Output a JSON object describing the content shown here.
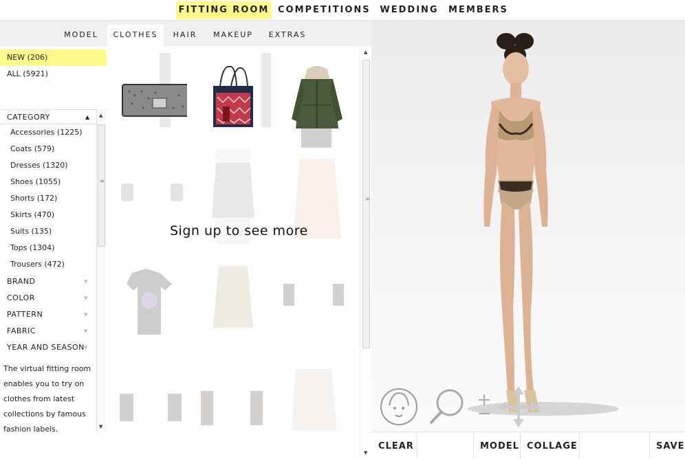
{
  "topnav": {
    "items": [
      {
        "label": "FITTING ROOM"
      },
      {
        "label": "COMPETITIONS"
      },
      {
        "label": "WEDDING"
      },
      {
        "label": "MEMBERS"
      }
    ]
  },
  "subtabs": [
    {
      "label": "MODEL"
    },
    {
      "label": "CLOTHES"
    },
    {
      "label": "HAIR"
    },
    {
      "label": "MAKEUP"
    },
    {
      "label": "EXTRAS"
    }
  ],
  "filters": {
    "new": "NEW (206)",
    "all": "ALL (5921)",
    "category_header": "CATEGORY",
    "categories": [
      {
        "label": "Accessories (1225)"
      },
      {
        "label": "Coats (579)"
      },
      {
        "label": "Dresses (1320)"
      },
      {
        "label": "Shoes (1055)"
      },
      {
        "label": "Shorts (172)"
      },
      {
        "label": "Skirts (470)"
      },
      {
        "label": "Suits (135)"
      },
      {
        "label": "Tops (1304)"
      },
      {
        "label": "Trousers (472)"
      }
    ],
    "facets": [
      {
        "label": "BRAND"
      },
      {
        "label": "COLOR"
      },
      {
        "label": "PATTERN"
      },
      {
        "label": "FABRIC"
      },
      {
        "label": "YEAR AND SEASON"
      }
    ],
    "description": "The virtual fitting room enables you to try on clothes from latest collections by famous fashion labels."
  },
  "grid": {
    "signup_text": "Sign up to see more"
  },
  "bottombar": {
    "clear": "CLEAR",
    "model": "MODEL",
    "collage": "COLLAGE",
    "save": "SAVE"
  },
  "colors": {
    "highlight": "#fdfa8c",
    "stage_bg": "#ececec"
  }
}
